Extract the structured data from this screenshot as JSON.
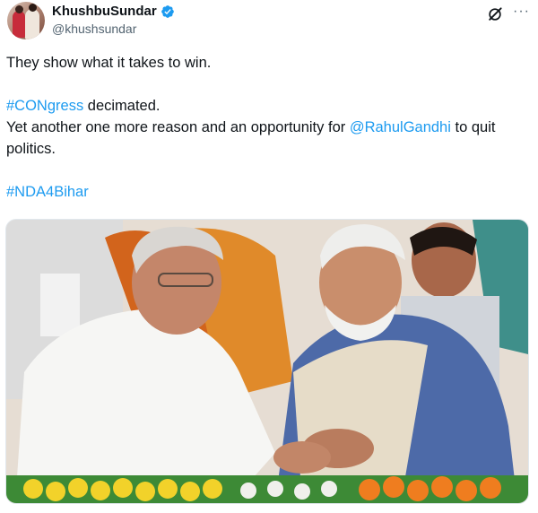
{
  "tweet": {
    "display_name": "KhushbuSundar",
    "handle": "@khushsundar",
    "line1": "They show what it takes to win.",
    "hashtag_cong": "#CONgress",
    "line2_rest": " decimated.",
    "line3_before": "Yet another one more reason and an opportunity for ",
    "mention": "@RahulGandhi",
    "line3_after": " to quit politics.",
    "hashtag_nda": "#NDA4Bihar"
  },
  "icons": {
    "verified": "verified-badge-icon",
    "grok": "grok-icon",
    "more": "more-options-icon"
  },
  "colors": {
    "link": "#1d9bf0",
    "verified": "#1d9bf0",
    "secondary_text": "#536471"
  }
}
